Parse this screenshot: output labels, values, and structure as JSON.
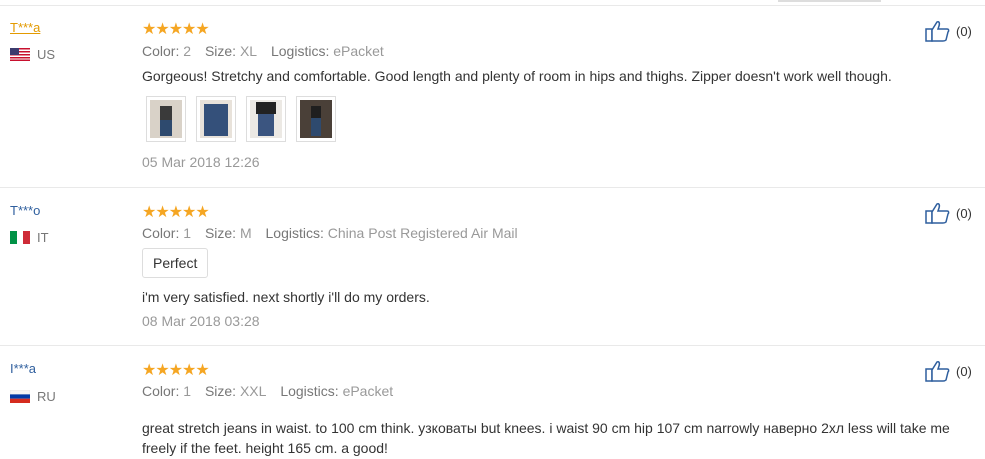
{
  "colors": {
    "star": "#f5a623",
    "user_link": "#2f5f9e",
    "user_highlight": "#e39a00"
  },
  "labels": {
    "color": "Color:",
    "size": "Size:",
    "logistics": "Logistics:"
  },
  "reviews": [
    {
      "user": "T***a",
      "country": "US",
      "stars": "★★★★★",
      "color": "2",
      "size": "XL",
      "logistics": "ePacket",
      "text": "Gorgeous! Stretchy and comfortable. Good length and plenty of room in hips and thighs. Zipper doesn't work well though.",
      "photos": [
        "photo-1",
        "photo-2",
        "photo-3",
        "photo-4"
      ],
      "date": "05 Mar 2018 12:26",
      "likes": "(0)"
    },
    {
      "user": "T***o",
      "country": "IT",
      "stars": "★★★★★",
      "color": "1",
      "size": "M",
      "logistics": "China Post Registered Air Mail",
      "tag": "Perfect",
      "text": "i'm very satisfied. next shortly i'll do my orders.",
      "date": "08 Mar 2018 03:28",
      "likes": "(0)"
    },
    {
      "user": "I***a",
      "country": "RU",
      "stars": "★★★★★",
      "color": "1",
      "size": "XXL",
      "logistics": "ePacket",
      "text": "great stretch jeans in waist. to 100 cm think. узковаты but knees. i waist 90 cm hip 107 cm narrowly наверно 2хл less will take me freely if the feet. height 165 cm. a good!",
      "likes": "(0)"
    }
  ]
}
